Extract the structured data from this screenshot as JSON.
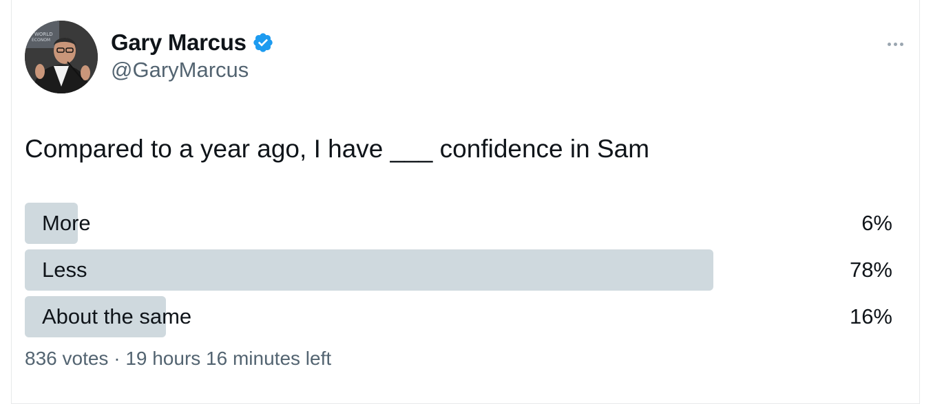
{
  "author": {
    "display_name": "Gary Marcus",
    "handle": "@GaryMarcus",
    "verified": true,
    "verified_color": "#1d9bf0",
    "avatar_icon": "profile-photo"
  },
  "more_icon": "more-horizontal-icon",
  "tweet": {
    "text": "Compared to a year ago, I have ___ confidence in Sam"
  },
  "poll": {
    "options": [
      {
        "label": "More",
        "percent": 6,
        "percent_label": "6%"
      },
      {
        "label": "Less",
        "percent": 78,
        "percent_label": "78%"
      },
      {
        "label": "About the same",
        "percent": 16,
        "percent_label": "16%"
      }
    ],
    "votes": "836 votes",
    "separator": "·",
    "time_left": "19 hours 16 minutes left",
    "bar_color": "#cfd9de"
  }
}
